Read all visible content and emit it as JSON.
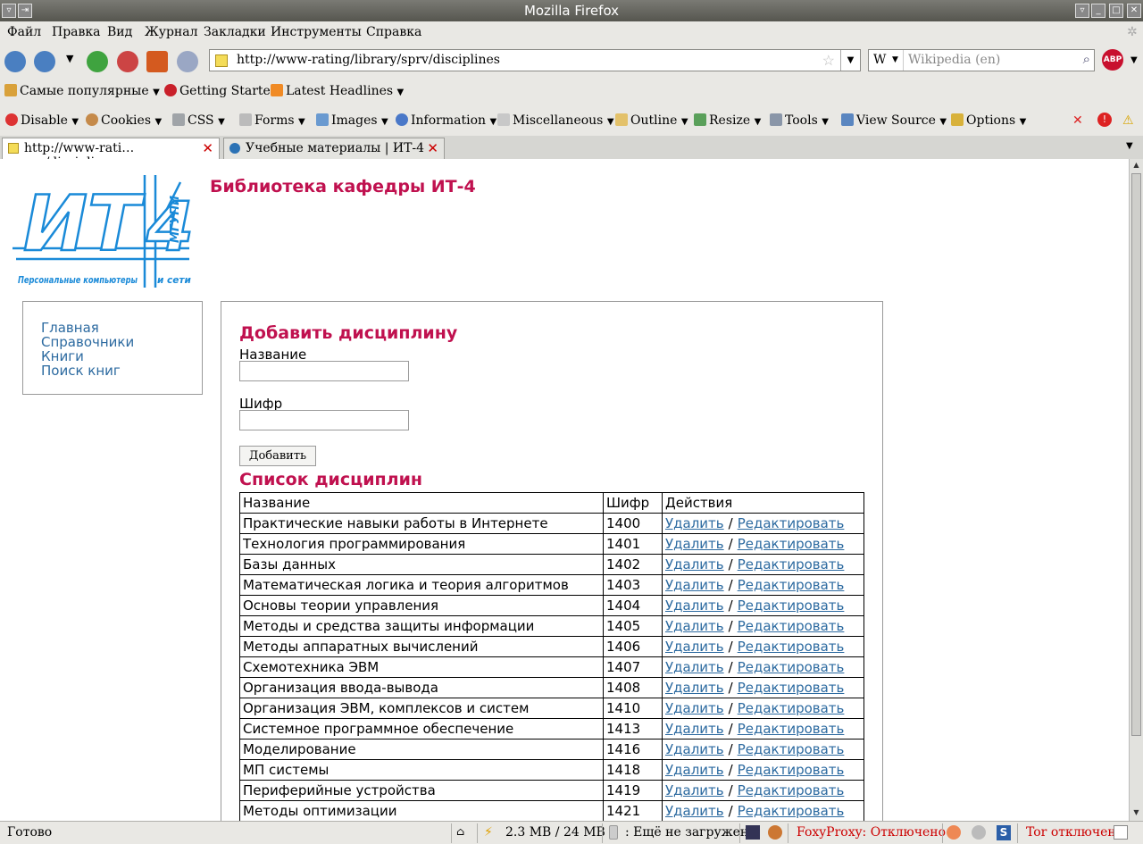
{
  "window": {
    "title": "Mozilla Firefox"
  },
  "menu": [
    "Файл",
    "Правка",
    "Вид",
    "Журнал",
    "Закладки",
    "Инструменты",
    "Справка"
  ],
  "nav": {
    "url": "http://www-rating/library/sprv/disciplines",
    "search_placeholder": "Wikipedia (en)",
    "search_engine": "W"
  },
  "bookmarks": [
    "Самые популярные",
    "Getting Started",
    "Latest Headlines"
  ],
  "devbar": [
    "Disable",
    "Cookies",
    "CSS",
    "Forms",
    "Images",
    "Information",
    "Miscellaneous",
    "Outline",
    "Resize",
    "Tools",
    "View Source",
    "Options"
  ],
  "tabs": [
    {
      "label": "http://www-rati…prv/disciplines"
    },
    {
      "label": "Учебные материалы | ИТ-4"
    }
  ],
  "page": {
    "site_title": "Библиотека кафедры ИТ-4",
    "logo": {
      "letters": "ИТ",
      "digit": "4",
      "vertical": "МГУПИ",
      "caption_left": "Персональные компьютеры",
      "caption_right": "и сети"
    },
    "sidebar": [
      "Главная",
      "Справочники",
      "Книги",
      "Поиск книг"
    ],
    "form": {
      "heading": "Добавить дисциплину",
      "name_label": "Название",
      "code_label": "Шифр",
      "submit": "Добавить"
    },
    "list_heading": "Список дисциплин",
    "table": {
      "headers": [
        "Название",
        "Шифр",
        "Действия"
      ],
      "delete_label": "Удалить",
      "edit_label": "Редактировать",
      "separator": "/",
      "rows": [
        {
          "name": "Практические навыки работы в Интернете",
          "code": "1400"
        },
        {
          "name": "Технология программирования",
          "code": "1401"
        },
        {
          "name": "Базы данных",
          "code": "1402"
        },
        {
          "name": "Математическая логика и теория алгоритмов",
          "code": "1403"
        },
        {
          "name": "Основы теории управления",
          "code": "1404"
        },
        {
          "name": "Методы и средства защиты информации",
          "code": "1405"
        },
        {
          "name": "Методы аппаратных вычислений",
          "code": "1406"
        },
        {
          "name": "Схемотехника ЭВМ",
          "code": "1407"
        },
        {
          "name": "Организация ввода-вывода",
          "code": "1408"
        },
        {
          "name": "Организация ЭВМ, комплексов и систем",
          "code": "1410"
        },
        {
          "name": "Системное программное обеспечение",
          "code": "1413"
        },
        {
          "name": "Моделирование",
          "code": "1416"
        },
        {
          "name": "МП системы",
          "code": "1418"
        },
        {
          "name": "Периферийные устройства",
          "code": "1419"
        },
        {
          "name": "Методы оптимизации",
          "code": "1421"
        }
      ]
    }
  },
  "status": {
    "text": "Готово",
    "memory": "2.3 MB / 24 MB",
    "loading": ": Ещё не загружен",
    "foxyproxy": "FoxyProxy: Отключено",
    "tor": "Tor отключен"
  },
  "colors": {
    "accent": "#c0114f",
    "link": "#2c6aa0",
    "logo": "#1a8ad8"
  }
}
